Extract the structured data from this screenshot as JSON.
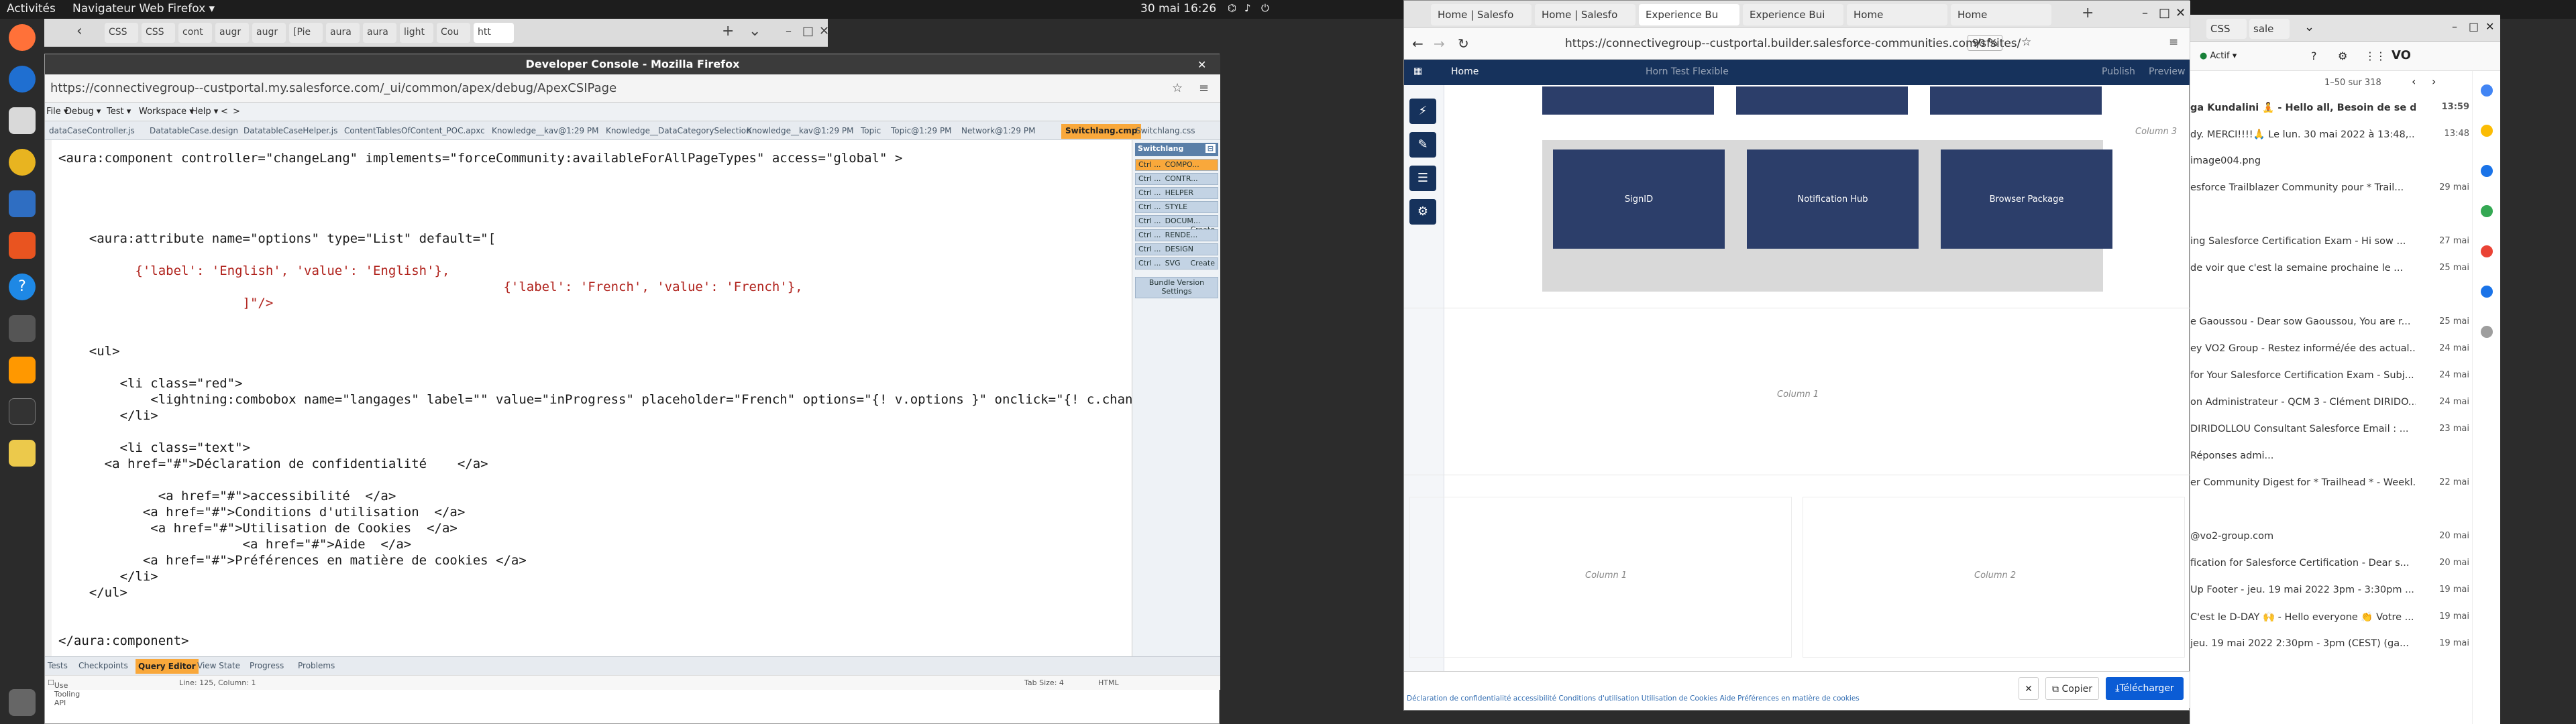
{
  "topbar": {
    "activities": "Activités",
    "app_menu": "Navigateur Web Firefox ▾",
    "clock": "30 mai  16:26",
    "tray_icons": [
      "network-icon",
      "volume-icon",
      "power-icon",
      "menu-arrow-icon"
    ]
  },
  "dock": {
    "apps": [
      "firefox-icon",
      "thunderbird-icon",
      "files-icon",
      "rhythmbox-icon",
      "writer-icon",
      "software-icon",
      "help-icon",
      "disk-icon",
      "sublime-icon",
      "terminal-icon",
      "notes-icon",
      "trash-icon",
      "apps-grid-icon"
    ]
  },
  "firefox_left_tabs": {
    "nav_back": "‹",
    "tabs": [
      {
        "label": "CSS"
      },
      {
        "label": "CSS"
      },
      {
        "label": "cont"
      },
      {
        "label": "augr"
      },
      {
        "label": "augr"
      },
      {
        "label": "[Pie"
      },
      {
        "label": "aura"
      },
      {
        "label": "aura"
      },
      {
        "label": "light"
      },
      {
        "label": "Cou"
      },
      {
        "label": "htt"
      }
    ],
    "new_tab": "+",
    "overflow": "⌄"
  },
  "devconsole": {
    "title": "Developer Console - Mozilla Firefox",
    "url": "https://connectivegroup--custportal.my.salesforce.com/_ui/common/apex/debug/ApexCSIPage",
    "menu": [
      "File ▾",
      "Debug ▾",
      "Test ▾",
      "Workspace ▾",
      "Help ▾",
      "<",
      ">"
    ],
    "file_tabs": [
      "dataCaseController.js",
      "DatatableCase.design",
      "DatatableCaseHelper.js",
      "ContentTablesOfContent_POC.apxc",
      "Knowledge__kav@1:29 PM",
      "Knowledge__DataCategorySelection",
      "Knowledge__kav@1:29 PM",
      "Topic",
      "Topic@1:29 PM",
      "Network@1:29 PM",
      "Switchlang.cmp",
      "Switchlang.css"
    ],
    "active_file_index": 10,
    "code_lines": [
      "<aura:component controller=\"changeLang\" implements=\"forceCommunity:availableForAllPageTypes\" access=\"global\" >",
      "",
      "",
      "",
      "",
      "    <aura:attribute name=\"options\" type=\"List\" default=\"[",
      "",
      "          {'label': 'English', 'value': 'English'},",
      "                                                          {'label': 'French', 'value': 'French'},",
      "                        ]\"/>",
      "",
      "",
      "    <ul>",
      "",
      "        <li class=\"red\">",
      "            <lightning:combobox name=\"langages\" label=\"\" value=\"inProgress\" placeholder=\"French\" options=\"{! v.options }\" onclick=\"{! c.changeLangua",
      "        </li>",
      "",
      "        <li class=\"text\">",
      "      <a href=\"#\">Déclaration de confidentialité    </a>",
      "",
      "             <a href=\"#\">accessibilité  </a>",
      "           <a href=\"#\">Conditions d'utilisation  </a>",
      "            <a href=\"#\">Utilisation de Cookies  </a>",
      "                        <a href=\"#\">Aide  </a>",
      "           <a href=\"#\">Préférences en matière de cookies </a>",
      "        </li>",
      "    </ul>",
      "",
      "",
      "</aura:component>"
    ],
    "sidebar": {
      "title": "Switchlang",
      "items": [
        {
          "key": "Ctrl ...",
          "label": "COMPO...",
          "active": true
        },
        {
          "key": "Ctrl ...",
          "label": "CONTR...",
          "active": false
        },
        {
          "key": "Ctrl ...",
          "label": "HELPER",
          "active": false
        },
        {
          "key": "Ctrl ...",
          "label": "STYLE",
          "active": false
        },
        {
          "key": "Ctrl ...",
          "label": "DOCUM...",
          "extra": "Create",
          "active": false
        },
        {
          "key": "Ctrl ...",
          "label": "RENDE...",
          "active": false
        },
        {
          "key": "Ctrl ...",
          "label": "DESIGN",
          "active": false
        },
        {
          "key": "Ctrl ...",
          "label": "SVG",
          "extra": "Create",
          "active": false
        }
      ],
      "bundle_version": "Bundle Version Settings"
    },
    "bottom_tabs": [
      "Tests",
      "Checkpoints",
      "Query Editor",
      "View State",
      "Progress",
      "Problems"
    ],
    "active_bottom_tab_index": 2,
    "status_left": "Line: 125, Column: 1",
    "status_mid": "Tab Size: 4",
    "status_right": "HTML",
    "logs_label": "Use Tooling API"
  },
  "builder": {
    "tabs": [
      {
        "label": "Home | Salesfo",
        "active": false
      },
      {
        "label": "Home | Salesfo",
        "active": false
      },
      {
        "label": "Experience Bu",
        "active": true
      },
      {
        "label": "Experience Bui",
        "active": false
      },
      {
        "label": "Home",
        "active": false
      },
      {
        "label": "Home",
        "active": false
      }
    ],
    "url": "https://connectivegroup--custportal.builder.salesforce-communities.com/sfsites/",
    "zoom": "90 %",
    "bar": {
      "page": "Home",
      "theme": "Horn Test Flexible",
      "publish": "Publish",
      "preview": "Preview"
    },
    "tiles_row1": [
      "",
      "",
      ""
    ],
    "tiles_row2": [
      "SignID",
      "Notification Hub",
      "Browser Package"
    ],
    "col_labels": {
      "col3": "Column 3",
      "col1a": "Column 1",
      "col1b": "Column 1",
      "col2": "Column 2"
    },
    "footer_links": "Déclaration de confidentialité accessibilité Conditions d'utilisation Utilisation de Cookies Aide Préférences en matière de cookies",
    "copy_button": "Copier",
    "download_button": "Télécharger"
  },
  "gmail": {
    "tabs": [
      "CSS",
      "sale",
      "⌄"
    ],
    "status": "Actif ▾",
    "pagination": "1–50 sur 318",
    "emails": [
      {
        "text": "ga Kundalini 🧘 - Hello all, Besoin de se déte...",
        "date": "13:59",
        "bold": true
      },
      {
        "text": "dy. MERCI!!!!🙏 Le lun. 30 mai 2022 à 13:48,...",
        "date": "13:48",
        "bold": false
      },
      {
        "text": "image004.png",
        "date": "",
        "bold": false
      },
      {
        "text": "esforce Trailblazer Community pour * Trail...",
        "date": "29 mai",
        "bold": false
      },
      {
        "text": "",
        "date": "",
        "bold": false
      },
      {
        "text": "ing Salesforce Certification Exam - Hi sow ...",
        "date": "27 mai",
        "bold": false
      },
      {
        "text": "de voir que c'est la semaine prochaine le ...",
        "date": "25 mai",
        "bold": false
      },
      {
        "text": "",
        "date": "",
        "bold": false
      },
      {
        "text": "e Gaoussou - Dear sow Gaoussou, You are r...",
        "date": "25 mai",
        "bold": false
      },
      {
        "text": "ey VO2 Group - Restez informé/ée des actual...",
        "date": "24 mai",
        "bold": false
      },
      {
        "text": "for Your Salesforce Certification Exam - Subj...",
        "date": "24 mai",
        "bold": false
      },
      {
        "text": "on Administrateur - QCM 3 - Clément DIRIDO...",
        "date": "24 mai",
        "bold": false
      },
      {
        "text": "DIRIDOLLOU Consultant Salesforce Email : ...",
        "date": "23 mai",
        "bold": false
      },
      {
        "text": "Réponses admi...",
        "date": "",
        "bold": false
      },
      {
        "text": "er Community Digest for * Trailhead * - Weekl...",
        "date": "22 mai",
        "bold": false
      },
      {
        "text": "",
        "date": "",
        "bold": false
      },
      {
        "text": "@vo2-group.com",
        "date": "20 mai",
        "bold": false
      },
      {
        "text": "fication for Salesforce Certification - Dear s...",
        "date": "20 mai",
        "bold": false
      },
      {
        "text": "Up Footer - jeu. 19 mai 2022 3pm - 3:30pm ...",
        "date": "19 mai",
        "bold": false
      },
      {
        "text": "C'est le D-DAY 🙌 - Hello everyone 👏 Votre ...",
        "date": "19 mai",
        "bold": false
      },
      {
        "text": "jeu. 19 mai 2022 2:30pm - 3pm (CEST) (ga...",
        "date": "19 mai",
        "bold": false
      }
    ],
    "rail_colors": [
      "#4285f4",
      "#fbbc04",
      "#1a73e8",
      "#34a853",
      "#ea4335",
      "#1a73e8",
      "#9e9e9e"
    ]
  }
}
